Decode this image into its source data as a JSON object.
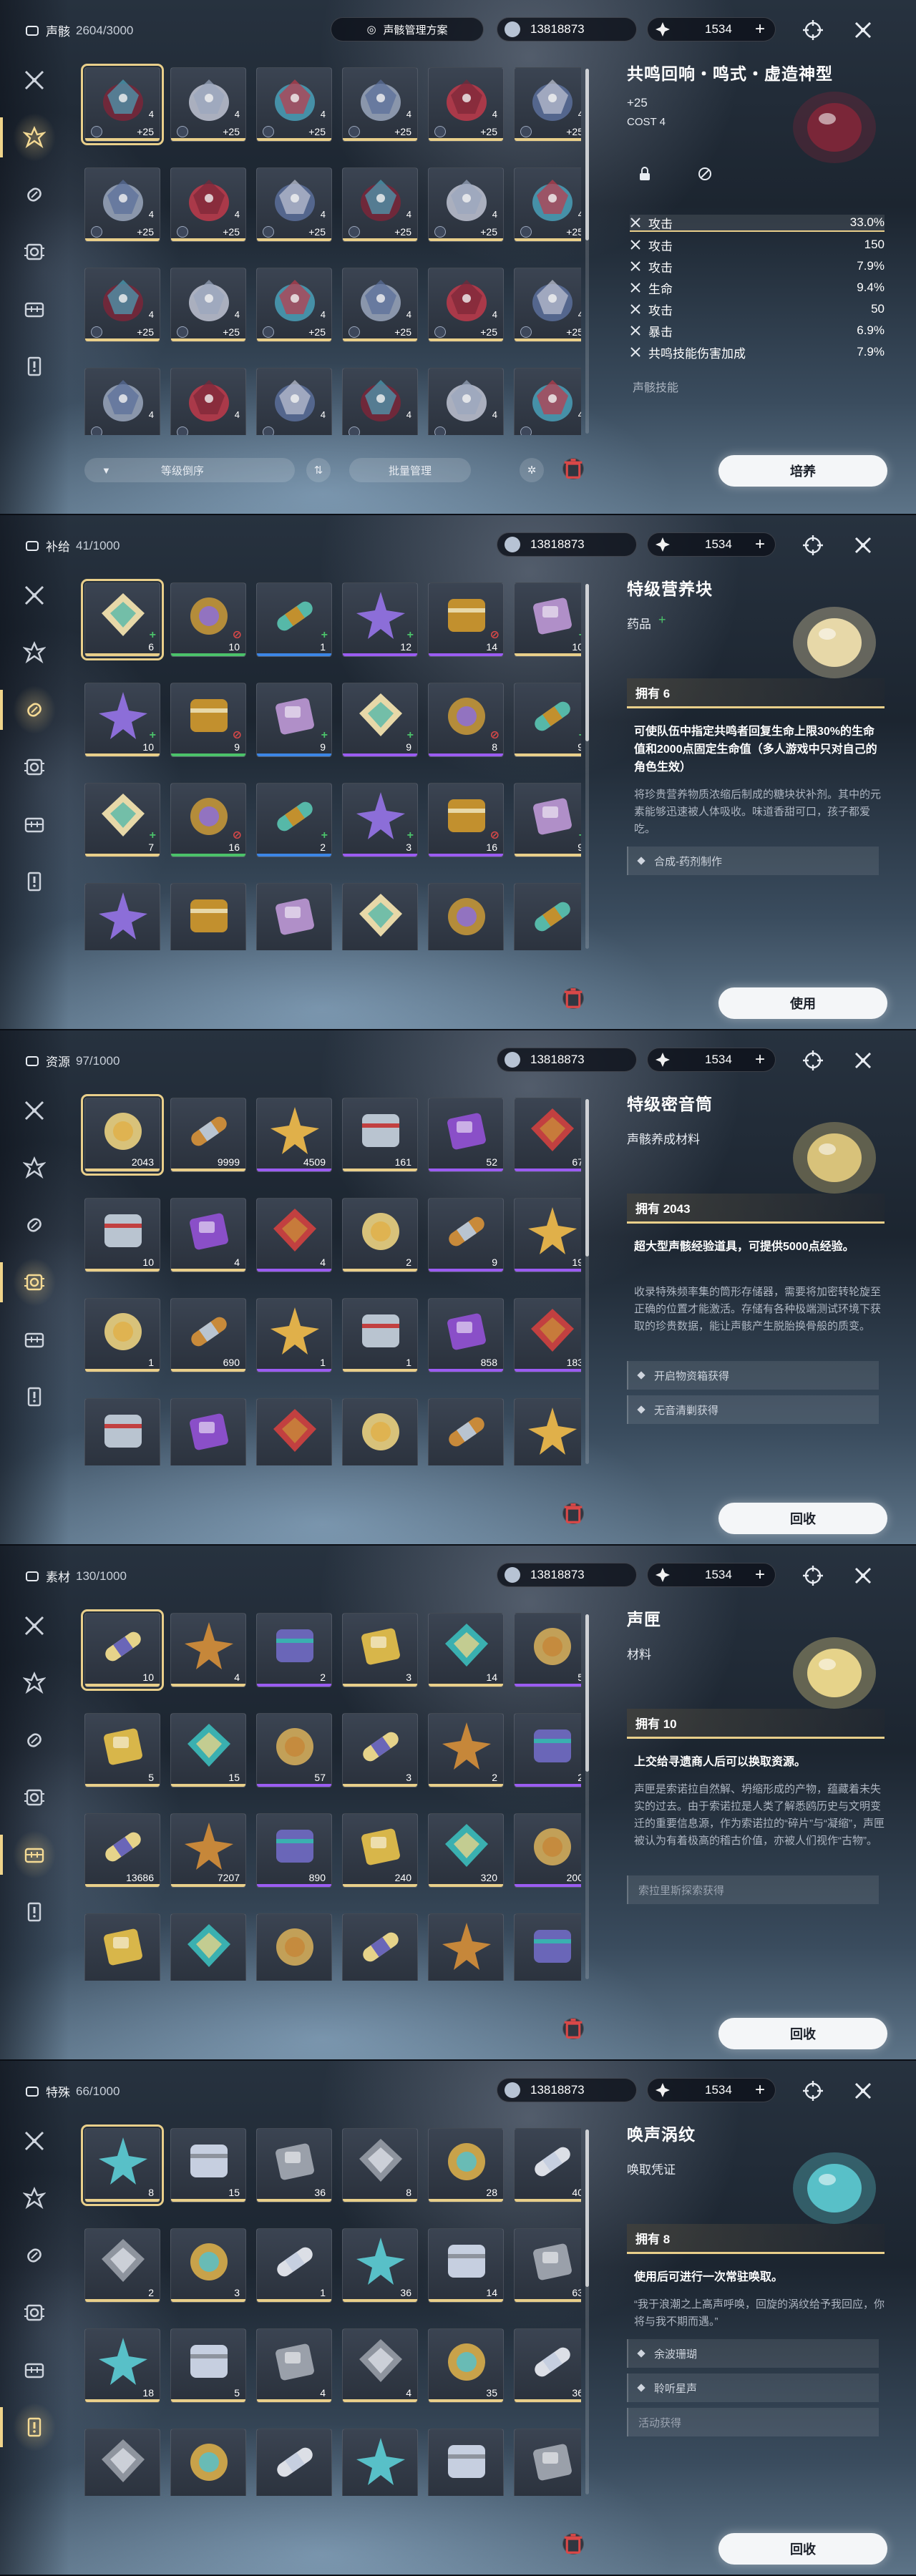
{
  "currency": {
    "amount": "13818873",
    "premium": "1534",
    "plus": "+"
  },
  "panels": [
    {
      "title": "声骸",
      "count": "2604/3000",
      "scheme_label": "声骸管理方案",
      "detail": {
        "name": "共鸣回响・鸣式・虚造神型",
        "plus": "+25",
        "cost": "COST  4"
      },
      "stats": [
        {
          "label": "攻击",
          "value": "33.0%"
        },
        {
          "label": "攻击",
          "value": "150"
        },
        {
          "label": "攻击",
          "value": "7.9%"
        },
        {
          "label": "生命",
          "value": "9.4%"
        },
        {
          "label": "攻击",
          "value": "50"
        },
        {
          "label": "暴击",
          "value": "6.9%"
        },
        {
          "label": "共鸣技能伤害加成",
          "value": "7.9%"
        }
      ],
      "skill_label": "声骸技能",
      "sort_label": "等级倒序",
      "batch_label": "批量管理",
      "button": "培养",
      "cells": [
        {
          "lv": "4",
          "plus": "+25"
        },
        {
          "lv": "4",
          "plus": "+25"
        },
        {
          "lv": "4",
          "plus": "+25"
        },
        {
          "lv": "4",
          "plus": "+25"
        },
        {
          "lv": "4",
          "plus": "+25"
        },
        {
          "lv": "4",
          "plus": "+25"
        },
        {
          "lv": "4",
          "plus": "+25"
        },
        {
          "lv": "4",
          "plus": "+25"
        },
        {
          "lv": "4",
          "plus": "+25"
        },
        {
          "lv": "4",
          "plus": "+25"
        },
        {
          "lv": "4",
          "plus": "+25"
        },
        {
          "lv": "4",
          "plus": "+25"
        },
        {
          "lv": "4",
          "plus": "+25"
        },
        {
          "lv": "4",
          "plus": "+25"
        },
        {
          "lv": "4",
          "plus": "+25"
        },
        {
          "lv": "4",
          "plus": "+25"
        },
        {
          "lv": "4",
          "plus": "+25"
        },
        {
          "lv": "4",
          "plus": "+25"
        },
        {
          "lv": "4",
          "plus": ""
        },
        {
          "lv": "4",
          "plus": ""
        },
        {
          "lv": "4",
          "plus": ""
        },
        {
          "lv": "4",
          "plus": ""
        },
        {
          "lv": "4",
          "plus": ""
        },
        {
          "lv": "4",
          "plus": ""
        }
      ]
    },
    {
      "title": "补给",
      "count": "41/1000",
      "detail": {
        "name": "特级营养块",
        "sub": "药品"
      },
      "owned": "拥有 6",
      "desc_bold": "可使队伍中指定共鸣者回复生命上限30%的生命值和2000点固定生命值（多人游戏中只对自己的角色生效）",
      "desc": "将珍贵营养物质浓缩后制成的糖块状补剂。其中的元素能够迅速被人体吸收。味道香甜可口，孩子都爱吃。",
      "sources": [
        "合成-药剂制作"
      ],
      "button": "使用",
      "cells": [
        {
          "c": "6"
        },
        {
          "c": "10"
        },
        {
          "c": "1"
        },
        {
          "c": "12"
        },
        {
          "c": "14"
        },
        {
          "c": "10"
        },
        {
          "c": "10"
        },
        {
          "c": "9"
        },
        {
          "c": "9"
        },
        {
          "c": "9"
        },
        {
          "c": "8"
        },
        {
          "c": "9"
        },
        {
          "c": "7"
        },
        {
          "c": "16"
        },
        {
          "c": "2"
        },
        {
          "c": "3"
        },
        {
          "c": "16"
        },
        {
          "c": "9"
        },
        {
          "c": ""
        },
        {
          "c": ""
        },
        {
          "c": ""
        },
        {
          "c": ""
        },
        {
          "c": ""
        },
        {
          "c": ""
        }
      ]
    },
    {
      "title": "资源",
      "count": "97/1000",
      "detail": {
        "name": "特级密音筒",
        "sub": "声骸养成材料"
      },
      "owned": "拥有 2043",
      "desc_bold": "超大型声骸经验道具，可提供5000点经验。",
      "desc": "收录特殊频率集的筒形存储器，需要将加密转轮旋至正确的位置才能激活。存储有各种极端测试环境下获取的珍贵数据，能让声骸产生脱胎换骨般的质变。",
      "sources": [
        "开启物资箱获得",
        "无音清剿获得"
      ],
      "button": "回收",
      "cells": [
        {
          "c": "2043"
        },
        {
          "c": "9999"
        },
        {
          "c": "4509"
        },
        {
          "c": "161"
        },
        {
          "c": "52"
        },
        {
          "c": "67"
        },
        {
          "c": "10"
        },
        {
          "c": "4"
        },
        {
          "c": "4"
        },
        {
          "c": "2"
        },
        {
          "c": "9"
        },
        {
          "c": "19"
        },
        {
          "c": "1"
        },
        {
          "c": "690"
        },
        {
          "c": "1"
        },
        {
          "c": "1"
        },
        {
          "c": "858"
        },
        {
          "c": "183"
        },
        {
          "c": ""
        },
        {
          "c": ""
        },
        {
          "c": ""
        },
        {
          "c": ""
        },
        {
          "c": ""
        },
        {
          "c": ""
        }
      ]
    },
    {
      "title": "素材",
      "count": "130/1000",
      "detail": {
        "name": "声匣",
        "sub": "材料"
      },
      "owned": "拥有 10",
      "desc_bold": "上交给寻遗商人后可以换取资源。",
      "desc": "声匣是索诺拉自然解、坍缩形成的产物，蕴藏着未失实的过去。由于索诺拉是人类了解悉鸥历史与文明变迁的重要信息源，作为索诺拉的“碎片”与“凝缩”，声匣被认为有着极高的稽古价值，亦被人们视作“古物”。",
      "sources_plain": [
        "索拉里斯探索获得"
      ],
      "button": "回收",
      "cells": [
        {
          "c": "10"
        },
        {
          "c": "4"
        },
        {
          "c": "2"
        },
        {
          "c": "3"
        },
        {
          "c": "14"
        },
        {
          "c": "5"
        },
        {
          "c": "5"
        },
        {
          "c": "15"
        },
        {
          "c": "57"
        },
        {
          "c": "3"
        },
        {
          "c": "2"
        },
        {
          "c": "2"
        },
        {
          "c": "13686"
        },
        {
          "c": "7207"
        },
        {
          "c": "890"
        },
        {
          "c": "240"
        },
        {
          "c": "320"
        },
        {
          "c": "200"
        },
        {
          "c": ""
        },
        {
          "c": ""
        },
        {
          "c": ""
        },
        {
          "c": ""
        },
        {
          "c": ""
        },
        {
          "c": ""
        }
      ]
    },
    {
      "title": "特殊",
      "count": "66/1000",
      "detail": {
        "name": "唤声涡纹",
        "sub": "唤取凭证"
      },
      "owned": "拥有 8",
      "desc_bold": "使用后可进行一次常驻唤取。",
      "desc": "“我于浪潮之上高声呼唤，回旋的涡纹给予我回应，你将与我不期而遇。”",
      "sources": [
        "余波珊瑚",
        "聆听星声"
      ],
      "sources_plain": [
        "活动获得"
      ],
      "button": "回收",
      "cells": [
        {
          "c": "8"
        },
        {
          "c": "15"
        },
        {
          "c": "36"
        },
        {
          "c": "8"
        },
        {
          "c": "28"
        },
        {
          "c": "40"
        },
        {
          "c": "2"
        },
        {
          "c": "3"
        },
        {
          "c": "1"
        },
        {
          "c": "36"
        },
        {
          "c": "14"
        },
        {
          "c": "63"
        },
        {
          "c": "18"
        },
        {
          "c": "5"
        },
        {
          "c": "4"
        },
        {
          "c": "4"
        },
        {
          "c": "35"
        },
        {
          "c": "36"
        },
        {
          "c": ""
        },
        {
          "c": ""
        },
        {
          "c": ""
        },
        {
          "c": ""
        },
        {
          "c": ""
        },
        {
          "c": ""
        }
      ]
    }
  ],
  "colors": {
    "gold": "#e9cf8a",
    "purple": "#9b5cf2",
    "blue": "#3c86e6",
    "green": "#4bc26a",
    "red": "#d94848"
  }
}
